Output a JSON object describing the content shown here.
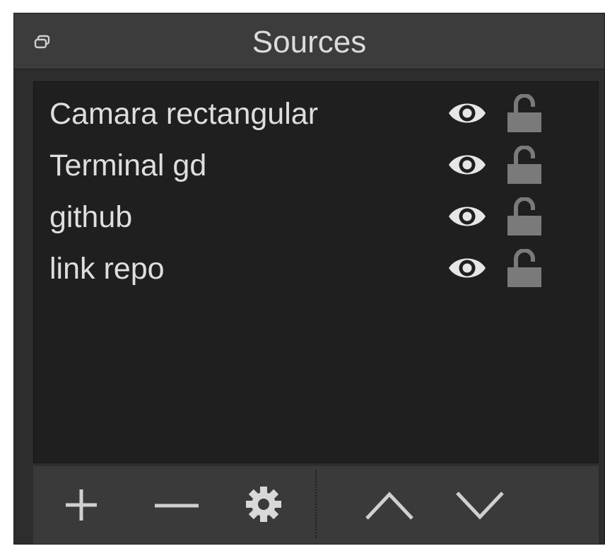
{
  "dock": {
    "title": "Sources",
    "title_icon": "float-window-icon"
  },
  "sources": {
    "items": [
      {
        "label": "Camara rectangular",
        "visible_icon": "eye-icon",
        "lock_icon": "unlocked-padlock-icon"
      },
      {
        "label": "Terminal gd",
        "visible_icon": "eye-icon",
        "lock_icon": "unlocked-padlock-icon"
      },
      {
        "label": "github",
        "visible_icon": "eye-icon",
        "lock_icon": "unlocked-padlock-icon"
      },
      {
        "label": "link repo",
        "visible_icon": "eye-icon",
        "lock_icon": "unlocked-padlock-icon"
      }
    ]
  },
  "toolbar": {
    "buttons": [
      "plus-icon",
      "minus-icon",
      "gear-icon",
      "chevron-up-icon",
      "chevron-down-icon"
    ]
  },
  "colors": {
    "panel_bg": "#2d2d2d",
    "title_bg": "#3c3c3c",
    "list_bg": "#1f1f1f",
    "toolbar_bg": "#3a3a3a",
    "text": "#dedede",
    "icon": "#e6e6e6",
    "lock": "#7a7a7a"
  }
}
